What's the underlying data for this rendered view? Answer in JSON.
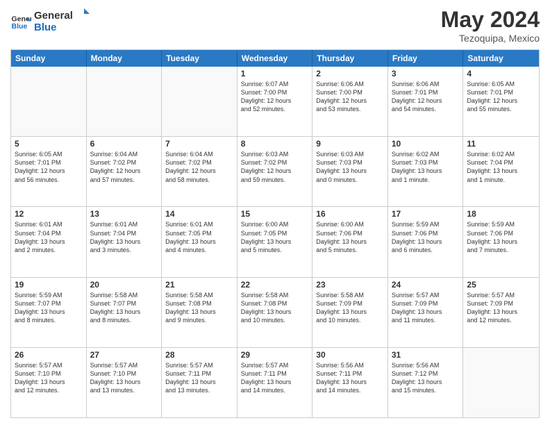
{
  "header": {
    "logo_line1": "General",
    "logo_line2": "Blue",
    "main_title": "May 2024",
    "subtitle": "Tezoquipa, Mexico"
  },
  "days_of_week": [
    "Sunday",
    "Monday",
    "Tuesday",
    "Wednesday",
    "Thursday",
    "Friday",
    "Saturday"
  ],
  "weeks": [
    [
      {
        "day": "",
        "text": "",
        "empty": true
      },
      {
        "day": "",
        "text": "",
        "empty": true
      },
      {
        "day": "",
        "text": "",
        "empty": true
      },
      {
        "day": "1",
        "text": "Sunrise: 6:07 AM\nSunset: 7:00 PM\nDaylight: 12 hours\nand 52 minutes.",
        "empty": false
      },
      {
        "day": "2",
        "text": "Sunrise: 6:06 AM\nSunset: 7:00 PM\nDaylight: 12 hours\nand 53 minutes.",
        "empty": false
      },
      {
        "day": "3",
        "text": "Sunrise: 6:06 AM\nSunset: 7:01 PM\nDaylight: 12 hours\nand 54 minutes.",
        "empty": false
      },
      {
        "day": "4",
        "text": "Sunrise: 6:05 AM\nSunset: 7:01 PM\nDaylight: 12 hours\nand 55 minutes.",
        "empty": false
      }
    ],
    [
      {
        "day": "5",
        "text": "Sunrise: 6:05 AM\nSunset: 7:01 PM\nDaylight: 12 hours\nand 56 minutes.",
        "empty": false
      },
      {
        "day": "6",
        "text": "Sunrise: 6:04 AM\nSunset: 7:02 PM\nDaylight: 12 hours\nand 57 minutes.",
        "empty": false
      },
      {
        "day": "7",
        "text": "Sunrise: 6:04 AM\nSunset: 7:02 PM\nDaylight: 12 hours\nand 58 minutes.",
        "empty": false
      },
      {
        "day": "8",
        "text": "Sunrise: 6:03 AM\nSunset: 7:02 PM\nDaylight: 12 hours\nand 59 minutes.",
        "empty": false
      },
      {
        "day": "9",
        "text": "Sunrise: 6:03 AM\nSunset: 7:03 PM\nDaylight: 13 hours\nand 0 minutes.",
        "empty": false
      },
      {
        "day": "10",
        "text": "Sunrise: 6:02 AM\nSunset: 7:03 PM\nDaylight: 13 hours\nand 1 minute.",
        "empty": false
      },
      {
        "day": "11",
        "text": "Sunrise: 6:02 AM\nSunset: 7:04 PM\nDaylight: 13 hours\nand 1 minute.",
        "empty": false
      }
    ],
    [
      {
        "day": "12",
        "text": "Sunrise: 6:01 AM\nSunset: 7:04 PM\nDaylight: 13 hours\nand 2 minutes.",
        "empty": false
      },
      {
        "day": "13",
        "text": "Sunrise: 6:01 AM\nSunset: 7:04 PM\nDaylight: 13 hours\nand 3 minutes.",
        "empty": false
      },
      {
        "day": "14",
        "text": "Sunrise: 6:01 AM\nSunset: 7:05 PM\nDaylight: 13 hours\nand 4 minutes.",
        "empty": false
      },
      {
        "day": "15",
        "text": "Sunrise: 6:00 AM\nSunset: 7:05 PM\nDaylight: 13 hours\nand 5 minutes.",
        "empty": false
      },
      {
        "day": "16",
        "text": "Sunrise: 6:00 AM\nSunset: 7:06 PM\nDaylight: 13 hours\nand 5 minutes.",
        "empty": false
      },
      {
        "day": "17",
        "text": "Sunrise: 5:59 AM\nSunset: 7:06 PM\nDaylight: 13 hours\nand 6 minutes.",
        "empty": false
      },
      {
        "day": "18",
        "text": "Sunrise: 5:59 AM\nSunset: 7:06 PM\nDaylight: 13 hours\nand 7 minutes.",
        "empty": false
      }
    ],
    [
      {
        "day": "19",
        "text": "Sunrise: 5:59 AM\nSunset: 7:07 PM\nDaylight: 13 hours\nand 8 minutes.",
        "empty": false
      },
      {
        "day": "20",
        "text": "Sunrise: 5:58 AM\nSunset: 7:07 PM\nDaylight: 13 hours\nand 8 minutes.",
        "empty": false
      },
      {
        "day": "21",
        "text": "Sunrise: 5:58 AM\nSunset: 7:08 PM\nDaylight: 13 hours\nand 9 minutes.",
        "empty": false
      },
      {
        "day": "22",
        "text": "Sunrise: 5:58 AM\nSunset: 7:08 PM\nDaylight: 13 hours\nand 10 minutes.",
        "empty": false
      },
      {
        "day": "23",
        "text": "Sunrise: 5:58 AM\nSunset: 7:09 PM\nDaylight: 13 hours\nand 10 minutes.",
        "empty": false
      },
      {
        "day": "24",
        "text": "Sunrise: 5:57 AM\nSunset: 7:09 PM\nDaylight: 13 hours\nand 11 minutes.",
        "empty": false
      },
      {
        "day": "25",
        "text": "Sunrise: 5:57 AM\nSunset: 7:09 PM\nDaylight: 13 hours\nand 12 minutes.",
        "empty": false
      }
    ],
    [
      {
        "day": "26",
        "text": "Sunrise: 5:57 AM\nSunset: 7:10 PM\nDaylight: 13 hours\nand 12 minutes.",
        "empty": false
      },
      {
        "day": "27",
        "text": "Sunrise: 5:57 AM\nSunset: 7:10 PM\nDaylight: 13 hours\nand 13 minutes.",
        "empty": false
      },
      {
        "day": "28",
        "text": "Sunrise: 5:57 AM\nSunset: 7:11 PM\nDaylight: 13 hours\nand 13 minutes.",
        "empty": false
      },
      {
        "day": "29",
        "text": "Sunrise: 5:57 AM\nSunset: 7:11 PM\nDaylight: 13 hours\nand 14 minutes.",
        "empty": false
      },
      {
        "day": "30",
        "text": "Sunrise: 5:56 AM\nSunset: 7:11 PM\nDaylight: 13 hours\nand 14 minutes.",
        "empty": false
      },
      {
        "day": "31",
        "text": "Sunrise: 5:56 AM\nSunset: 7:12 PM\nDaylight: 13 hours\nand 15 minutes.",
        "empty": false
      },
      {
        "day": "",
        "text": "",
        "empty": true
      }
    ]
  ]
}
